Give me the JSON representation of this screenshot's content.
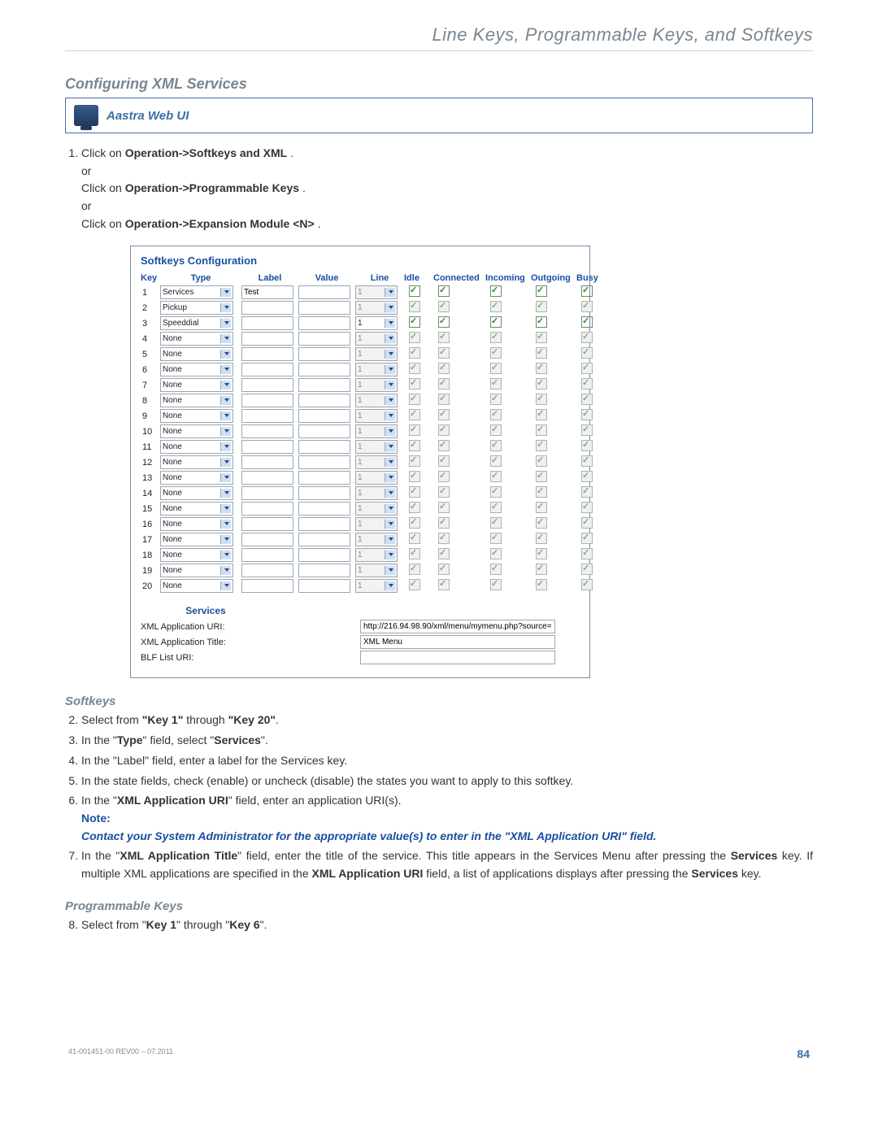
{
  "header": "Line Keys, Programmable Keys, and Softkeys",
  "section_title": "Configuring XML Services",
  "callout_label": "Aastra Web UI",
  "step1": {
    "num": "1.",
    "a1": "Click on ",
    "a2": "Operation->Softkeys and XML",
    "a3": ".",
    "or": "or",
    "b1": "Click on ",
    "b2": "Operation->Programmable Keys",
    "b3": ".",
    "c1": "Click on ",
    "c2": "Operation->Expansion Module <N>",
    "c3": "."
  },
  "config": {
    "title": "Softkeys Configuration",
    "headers": {
      "key": "Key",
      "type": "Type",
      "label": "Label",
      "value": "Value",
      "line": "Line",
      "idle": "Idle",
      "connected": "Connected",
      "incoming": "Incoming",
      "outgoing": "Outgoing",
      "busy": "Busy"
    },
    "rows": [
      {
        "key": "1",
        "type": "Services",
        "label": "Test",
        "value": "",
        "line": "1",
        "line_dis": true,
        "cb": [
          1,
          1,
          1,
          1,
          1
        ],
        "cb_dis": false
      },
      {
        "key": "2",
        "type": "Pickup",
        "label": "",
        "value": "",
        "line": "1",
        "line_dis": true,
        "cb": [
          1,
          1,
          1,
          1,
          1
        ],
        "cb_dis": true
      },
      {
        "key": "3",
        "type": "Speeddial",
        "label": "",
        "value": "",
        "line": "1",
        "line_dis": false,
        "cb": [
          1,
          1,
          1,
          1,
          1
        ],
        "cb_dis": false
      },
      {
        "key": "4",
        "type": "None",
        "label": "",
        "value": "",
        "line": "1",
        "line_dis": true,
        "cb": [
          1,
          1,
          1,
          1,
          1
        ],
        "cb_dis": true
      },
      {
        "key": "5",
        "type": "None",
        "label": "",
        "value": "",
        "line": "1",
        "line_dis": true,
        "cb": [
          1,
          1,
          1,
          1,
          1
        ],
        "cb_dis": true
      },
      {
        "key": "6",
        "type": "None",
        "label": "",
        "value": "",
        "line": "1",
        "line_dis": true,
        "cb": [
          1,
          1,
          1,
          1,
          1
        ],
        "cb_dis": true
      },
      {
        "key": "7",
        "type": "None",
        "label": "",
        "value": "",
        "line": "1",
        "line_dis": true,
        "cb": [
          1,
          1,
          1,
          1,
          1
        ],
        "cb_dis": true
      },
      {
        "key": "8",
        "type": "None",
        "label": "",
        "value": "",
        "line": "1",
        "line_dis": true,
        "cb": [
          1,
          1,
          1,
          1,
          1
        ],
        "cb_dis": true
      },
      {
        "key": "9",
        "type": "None",
        "label": "",
        "value": "",
        "line": "1",
        "line_dis": true,
        "cb": [
          1,
          1,
          1,
          1,
          1
        ],
        "cb_dis": true
      },
      {
        "key": "10",
        "type": "None",
        "label": "",
        "value": "",
        "line": "1",
        "line_dis": true,
        "cb": [
          1,
          1,
          1,
          1,
          1
        ],
        "cb_dis": true
      },
      {
        "key": "11",
        "type": "None",
        "label": "",
        "value": "",
        "line": "1",
        "line_dis": true,
        "cb": [
          1,
          1,
          1,
          1,
          1
        ],
        "cb_dis": true
      },
      {
        "key": "12",
        "type": "None",
        "label": "",
        "value": "",
        "line": "1",
        "line_dis": true,
        "cb": [
          1,
          1,
          1,
          1,
          1
        ],
        "cb_dis": true
      },
      {
        "key": "13",
        "type": "None",
        "label": "",
        "value": "",
        "line": "1",
        "line_dis": true,
        "cb": [
          1,
          1,
          1,
          1,
          1
        ],
        "cb_dis": true
      },
      {
        "key": "14",
        "type": "None",
        "label": "",
        "value": "",
        "line": "1",
        "line_dis": true,
        "cb": [
          1,
          1,
          1,
          1,
          1
        ],
        "cb_dis": true
      },
      {
        "key": "15",
        "type": "None",
        "label": "",
        "value": "",
        "line": "1",
        "line_dis": true,
        "cb": [
          1,
          1,
          1,
          1,
          1
        ],
        "cb_dis": true
      },
      {
        "key": "16",
        "type": "None",
        "label": "",
        "value": "",
        "line": "1",
        "line_dis": true,
        "cb": [
          1,
          1,
          1,
          1,
          1
        ],
        "cb_dis": true
      },
      {
        "key": "17",
        "type": "None",
        "label": "",
        "value": "",
        "line": "1",
        "line_dis": true,
        "cb": [
          1,
          1,
          1,
          1,
          1
        ],
        "cb_dis": true
      },
      {
        "key": "18",
        "type": "None",
        "label": "",
        "value": "",
        "line": "1",
        "line_dis": true,
        "cb": [
          1,
          1,
          1,
          1,
          1
        ],
        "cb_dis": true
      },
      {
        "key": "19",
        "type": "None",
        "label": "",
        "value": "",
        "line": "1",
        "line_dis": true,
        "cb": [
          1,
          1,
          1,
          1,
          1
        ],
        "cb_dis": true
      },
      {
        "key": "20",
        "type": "None",
        "label": "",
        "value": "",
        "line": "1",
        "line_dis": true,
        "cb": [
          1,
          1,
          1,
          1,
          1
        ],
        "cb_dis": true
      }
    ],
    "services_header": "Services",
    "svc": {
      "uri_label": "XML Application URI:",
      "uri_value": "http://216.94.98.90/xml/menu/mymenu.php?source=",
      "title_label": "XML Application Title:",
      "title_value": "XML Menu",
      "blf_label": "BLF List URI:",
      "blf_value": ""
    }
  },
  "softkeys_heading": "Softkeys",
  "step2": {
    "num": "2.",
    "a": "Select from ",
    "b": "\"Key 1\"",
    "c": " through ",
    "d": "\"Key 20\"",
    "e": "."
  },
  "step3": {
    "num": "3.",
    "a": "In the \"",
    "b": "Type",
    "c": "\" field, select \"",
    "d": "Services",
    "e": "\"."
  },
  "step4": {
    "num": "4.",
    "text": "In the \"Label\" field, enter a label for the Services key."
  },
  "step5": {
    "num": "5.",
    "text": "In the state fields, check (enable) or uncheck (disable) the states you want to apply to this softkey."
  },
  "step6": {
    "num": "6.",
    "a": "In the \"",
    "b": "XML Application URI",
    "c": "\" field, enter an application URI(s).",
    "note_label": "Note:",
    "note_body": "Contact your System Administrator for the appropriate value(s) to enter in the \"XML Application URI\" field."
  },
  "step7": {
    "num": "7.",
    "a": "In the \"",
    "b": "XML Application Title",
    "c": "\" field, enter the title of the service. This title appears in the Services Menu after pressing the ",
    "d": "Services",
    "e": " key. If multiple XML applications are specified in the ",
    "f": "XML Application URI",
    "g": " field, a list of applications displays after pressing the ",
    "h": "Services",
    "i": " key."
  },
  "progkeys_heading": "Programmable Keys",
  "step8": {
    "num": "8.",
    "a": "Select from \"",
    "b": "Key 1",
    "c": "\" through \"",
    "d": "Key 6",
    "e": "\"."
  },
  "footer": {
    "rev": "41-001451-00 REV00 – 07.2011",
    "page": "84"
  }
}
